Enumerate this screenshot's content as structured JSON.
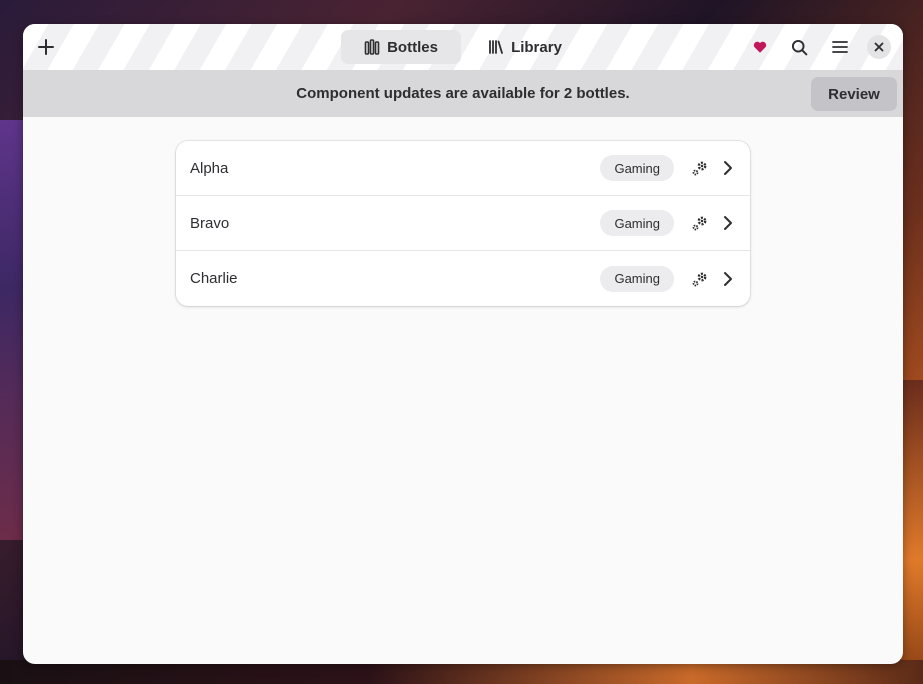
{
  "header": {
    "tabs": [
      {
        "label": "Bottles",
        "icon": "bottles-icon",
        "active": true
      },
      {
        "label": "Library",
        "icon": "library-icon",
        "active": false
      }
    ],
    "add_icon": "plus-icon",
    "heart_icon": "heart-icon",
    "search_icon": "search-icon",
    "menu_icon": "hamburger-menu-icon",
    "close_icon": "close-icon",
    "heart_color": "#c2185b"
  },
  "banner": {
    "message": "Component updates are available for 2 bottles.",
    "review_label": "Review"
  },
  "bottles": [
    {
      "name": "Alpha",
      "badge": "Gaming"
    },
    {
      "name": "Bravo",
      "badge": "Gaming"
    },
    {
      "name": "Charlie",
      "badge": "Gaming"
    }
  ]
}
